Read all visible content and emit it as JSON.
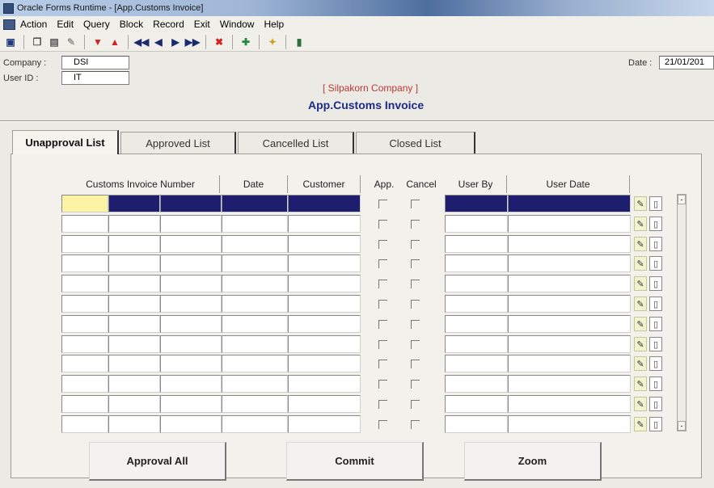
{
  "window": {
    "title": "Oracle Forms Runtime - [App.Customs Invoice]"
  },
  "menu": [
    "Action",
    "Edit",
    "Query",
    "Block",
    "Record",
    "Exit",
    "Window",
    "Help"
  ],
  "toolbar": [
    "save-icon",
    "copy-icon",
    "paste-icon",
    "clear-icon",
    "prev-block-icon",
    "next-block-icon",
    "first-record-icon",
    "prev-record-icon",
    "next-record-icon",
    "last-record-icon",
    "delete-record-icon",
    "insert-record-icon",
    "help-icon",
    "exit-icon"
  ],
  "header": {
    "company_label": "Company :",
    "company_value": "DSI",
    "userid_label": "User ID :",
    "userid_value": "IT",
    "company_name": "[ Silpakorn Company ]",
    "form_title": "App.Customs Invoice",
    "date_label": "Date :",
    "date_value": "21/01/201"
  },
  "tabs": [
    "Unapproval List",
    "Approved List",
    "Cancelled List",
    "Closed List"
  ],
  "grid": {
    "columns": {
      "number": "Customs Invoice Number",
      "date": "Date",
      "customer": "Customer",
      "app": "App.",
      "cancel": "Cancel",
      "user_by": "User By",
      "user_date": "User Date"
    },
    "row_count": 12
  },
  "buttons": {
    "approval_all": "Approval All",
    "commit": "Commit",
    "zoom": "Zoom"
  }
}
